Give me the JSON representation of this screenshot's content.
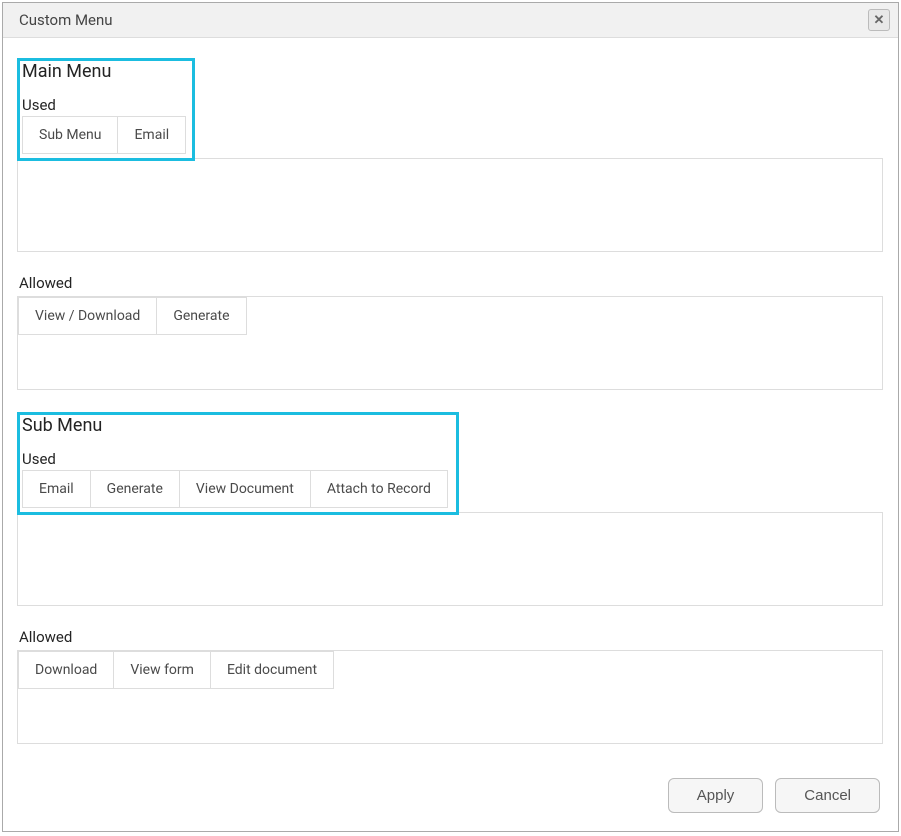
{
  "dialog": {
    "title": "Custom Menu"
  },
  "main_menu": {
    "title": "Main Menu",
    "used_label": "Used",
    "used_items": [
      "Sub Menu",
      "Email"
    ],
    "allowed_label": "Allowed",
    "allowed_items": [
      "View / Download",
      "Generate"
    ]
  },
  "sub_menu": {
    "title": "Sub Menu",
    "used_label": "Used",
    "used_items": [
      "Email",
      "Generate",
      "View Document",
      "Attach to Record"
    ],
    "allowed_label": "Allowed",
    "allowed_items": [
      "Download",
      "View form",
      "Edit document"
    ]
  },
  "footer": {
    "apply_label": "Apply",
    "cancel_label": "Cancel"
  }
}
